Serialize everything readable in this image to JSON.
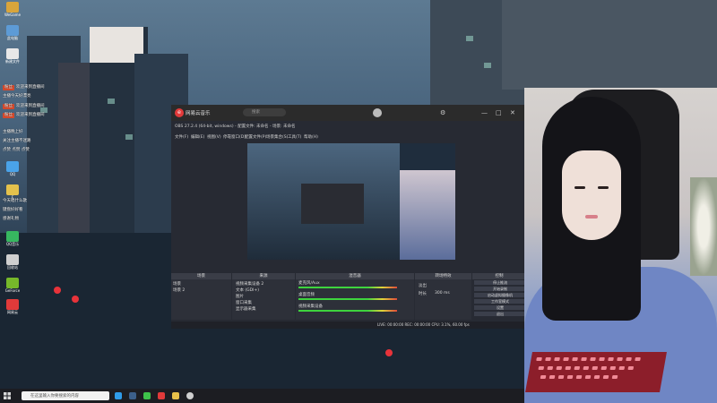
{
  "desktop": {
    "icons": [
      {
        "label": "WeGame",
        "color": "#d9a53b"
      },
      {
        "label": "此电脑",
        "color": "#5d9bd6"
      },
      {
        "label": "新建文件",
        "color": "#e8e8e8"
      },
      {
        "label": "QQ",
        "color": "#4aa3e8"
      },
      {
        "label": "F",
        "color": "#e3c14c"
      },
      {
        "label": "QQ音乐",
        "color": "#37b760"
      },
      {
        "label": "回收站",
        "color": "#cfcfcf"
      },
      {
        "label": "GeForce",
        "color": "#76b82a"
      },
      {
        "label": "网易云",
        "color": "#e13a3a"
      }
    ]
  },
  "chat": {
    "lines": [
      {
        "badge": "粉丝",
        "text": "欢迎来到直播间"
      },
      {
        "badge": "",
        "text": "主播今天好漂亮"
      },
      {
        "badge": "粉丝",
        "text": "欢迎来到直播间"
      },
      {
        "badge": "粉丝",
        "text": "欢迎来到直播间"
      },
      {
        "badge": "",
        "text": "主播晚上好"
      },
      {
        "badge": "",
        "text": "关注主播不迷路"
      },
      {
        "badge": "",
        "text": "点赞 点赞 点赞"
      },
      {
        "badge": "",
        "text": "今天唱什么歌"
      },
      {
        "badge": "",
        "text": "键盘好好看"
      },
      {
        "badge": "",
        "text": "感谢礼物"
      }
    ]
  },
  "music_app": {
    "logo": "e",
    "title": "网易云音乐",
    "search_placeholder": "搜索"
  },
  "obs": {
    "title": "OBS 27.2.4 (64-bit, windows) - 配置文件: 未命名 - 场景: 未命名",
    "menu": [
      "文件(F)",
      "编辑(E)",
      "视图(V)",
      "停靠窗口(D)",
      "配置文件(P)",
      "场景集合(S)",
      "工具(T)",
      "帮助(H)"
    ],
    "panels": {
      "scenes": "场景",
      "sources": "来源",
      "mixer": "混音器",
      "transitions": "转场特效",
      "controls": "控制"
    },
    "scene_list": [
      "场景",
      "场景 2"
    ],
    "source_list": [
      "视频采集设备 2",
      "文本 (GDI+)",
      "图片",
      "窗口采集",
      "显示器采集"
    ],
    "mixer_tracks": [
      "麦克风/Aux",
      "桌面音频",
      "视频采集设备"
    ],
    "transition_type": "淡出",
    "duration_label": "时长",
    "duration_value": "300 ms",
    "controls": [
      "停止推流",
      "开始录制",
      "启动虚拟摄像机",
      "工作室模式",
      "设置",
      "退出"
    ],
    "status": "LIVE: 00:00:00  REC: 00:00:00  CPU: 3.1%, 60.00 fps"
  },
  "taskbar": {
    "search_placeholder": "在这里输入你要搜索的内容",
    "apps": [
      {
        "name": "edge",
        "color": "#2f9be8"
      },
      {
        "name": "steam",
        "color": "#3c5f8a"
      },
      {
        "name": "wechat",
        "color": "#3ec24a"
      },
      {
        "name": "netease-music",
        "color": "#e13a3a"
      },
      {
        "name": "explorer",
        "color": "#e8c04a"
      },
      {
        "name": "obs",
        "color": "#cfcfcf"
      }
    ]
  },
  "colors": {
    "accent_red": "#e13a3a",
    "meter_green": "#3ed43e",
    "obs_bg": "#272a33"
  }
}
